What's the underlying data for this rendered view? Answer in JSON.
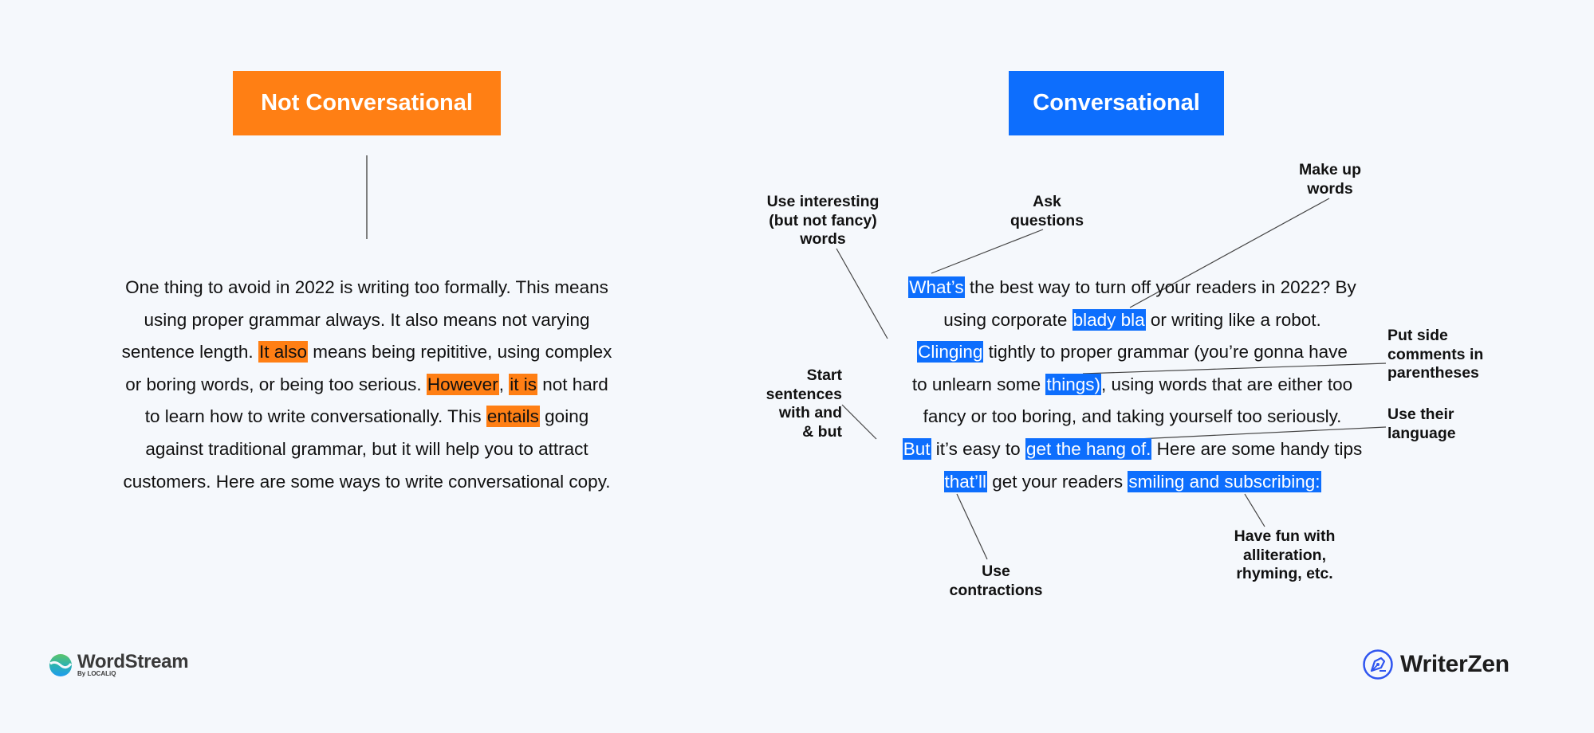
{
  "left": {
    "title": "Not Conversational",
    "color": "#FF7F14",
    "paragraph_lines": [
      [
        {
          "t": "One thing to avoid in 2022 is writing too formally. This means"
        }
      ],
      [
        {
          "t": "using proper grammar always. It also means not varying"
        }
      ],
      [
        {
          "t": "sentence length. "
        },
        {
          "t": "It also",
          "hl": true
        },
        {
          "t": " means being repititive, using complex"
        }
      ],
      [
        {
          "t": "or boring words, or being too serious. "
        },
        {
          "t": "However",
          "hl": true
        },
        {
          "t": ", "
        },
        {
          "t": "it is",
          "hl": true
        },
        {
          "t": " not hard"
        }
      ],
      [
        {
          "t": "to learn how to write conversationally. This "
        },
        {
          "t": "entails",
          "hl": true
        },
        {
          "t": " going"
        }
      ],
      [
        {
          "t": "against traditional grammar, but it will help you to attract"
        }
      ],
      [
        {
          "t": "customers. Here are some ways to write conversational copy."
        }
      ]
    ]
  },
  "right": {
    "title": "Conversational",
    "color": "#0D6EFD",
    "paragraph_lines": [
      [
        {
          "t": "What’s",
          "hl": true
        },
        {
          "t": " the best way to turn off your readers in 2022? By"
        }
      ],
      [
        {
          "t": "using corporate "
        },
        {
          "t": "blady bla",
          "hl": true
        },
        {
          "t": " or writing like a robot."
        }
      ],
      [
        {
          "t": "Clinging",
          "hl": true
        },
        {
          "t": " tightly to proper grammar (you’re gonna have"
        }
      ],
      [
        {
          "t": "to unlearn some "
        },
        {
          "t": "things)",
          "hl": true
        },
        {
          "t": ", using words that are either too"
        }
      ],
      [
        {
          "t": "fancy or too boring, and taking yourself too seriously."
        }
      ],
      [
        {
          "t": "But",
          "hl": true
        },
        {
          "t": " it’s easy to "
        },
        {
          "t": "get the hang of.",
          "hl": true
        },
        {
          "t": " Here are some handy tips"
        }
      ],
      [
        {
          "t": "that’ll",
          "hl": true
        },
        {
          "t": " get your readers "
        },
        {
          "t": "smiling and subscribing:",
          "hl": true
        }
      ]
    ]
  },
  "annotations": {
    "use_interesting": [
      "Use interesting",
      "(but not fancy)",
      "words"
    ],
    "ask_questions": [
      "Ask",
      "questions"
    ],
    "make_up_words": [
      "Make up",
      "words"
    ],
    "side_comments": [
      "Put side",
      "comments in",
      "parentheses"
    ],
    "start_sentences": [
      "Start",
      "sentences",
      "with and",
      "& but"
    ],
    "their_language": [
      "Use their",
      "language"
    ],
    "contractions": [
      "Use",
      "contractions"
    ],
    "have_fun": [
      "Have fun with",
      "alliteration,",
      "rhyming, etc."
    ]
  },
  "logos": {
    "left": {
      "name": "WordStream",
      "sub": "By LOCALiQ"
    },
    "right": {
      "name": "WriterZen"
    }
  },
  "colors": {
    "background": "#F5F8FC",
    "orange": "#FF7F14",
    "blue": "#0D6EFD",
    "connector": "#444444"
  }
}
